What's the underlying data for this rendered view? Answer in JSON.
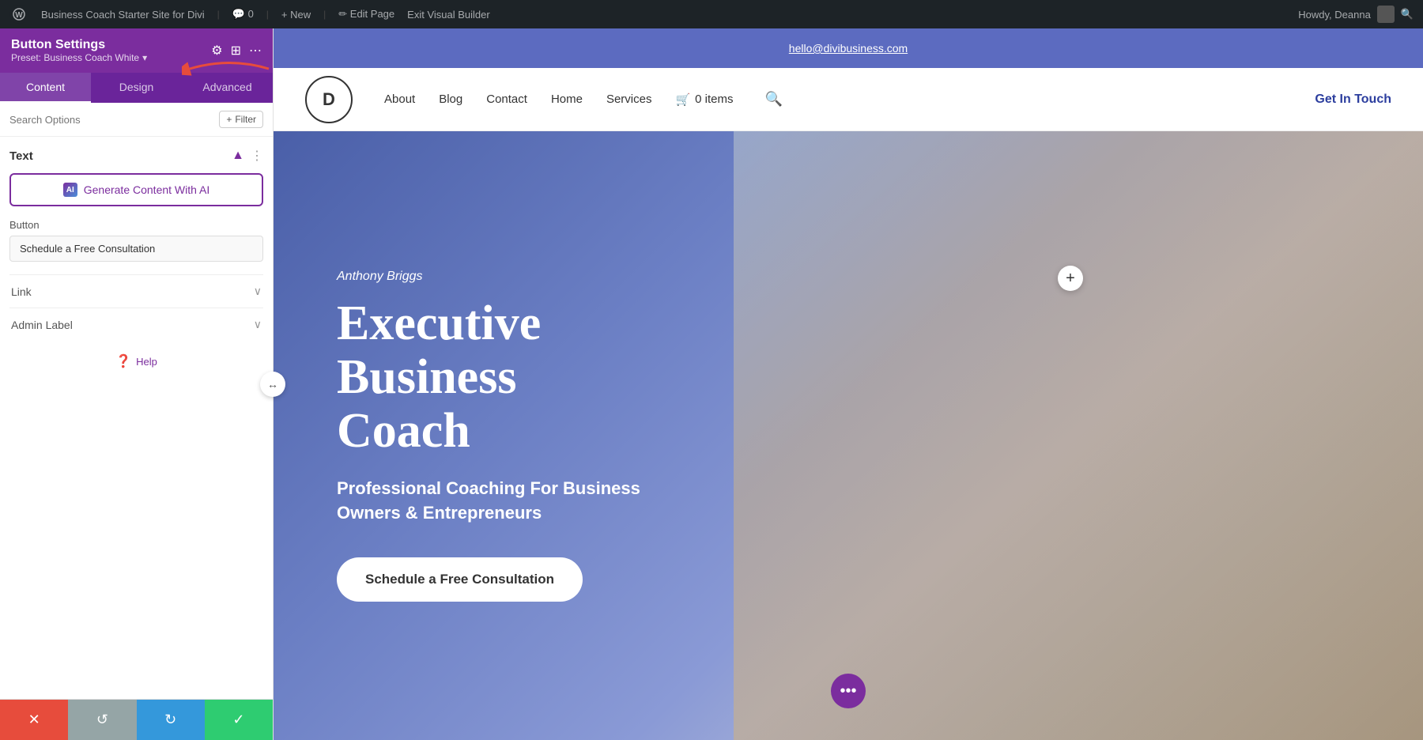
{
  "admin_bar": {
    "wp_logo": "W",
    "site_name": "Business Coach Starter Site for Divi",
    "comment_label": "💬 0",
    "new_label": "+ New",
    "edit_page_label": "✏ Edit Page",
    "exit_builder_label": "Exit Visual Builder",
    "howdy_label": "Howdy, Deanna",
    "search_icon": "🔍"
  },
  "sidebar": {
    "header_title": "Button Settings",
    "preset_label": "Preset: Business Coach White",
    "preset_arrow": "▾",
    "tabs": [
      {
        "label": "Content",
        "active": true
      },
      {
        "label": "Design",
        "active": false
      },
      {
        "label": "Advanced",
        "active": false
      }
    ],
    "search_placeholder": "Search Options",
    "filter_label": "⚡ Filter",
    "text_section": {
      "title": "Text",
      "generate_ai_label": "Generate Content With AI",
      "ai_icon_label": "AI"
    },
    "button_section": {
      "label": "Button",
      "value": "Schedule a Free Consultation"
    },
    "link_section": {
      "label": "Link"
    },
    "admin_label_section": {
      "label": "Admin Label"
    },
    "help_label": "Help"
  },
  "bottom_bar": {
    "close_icon": "✕",
    "undo_icon": "↺",
    "redo_icon": "↻",
    "save_icon": "✓"
  },
  "site": {
    "email": "hello@divibusiness.com",
    "logo_letter": "D",
    "nav": [
      {
        "label": "About"
      },
      {
        "label": "Blog"
      },
      {
        "label": "Contact"
      },
      {
        "label": "Home"
      },
      {
        "label": "Services"
      }
    ],
    "cart_icon": "🛒",
    "cart_items": "0 items",
    "search_icon": "🔍",
    "get_in_touch": "Get In Touch"
  },
  "hero": {
    "author": "Anthony Briggs",
    "title_line1": "Executive Business",
    "title_line2": "Coach",
    "subtitle": "Professional Coaching For Business Owners & Entrepreneurs",
    "cta_button": "Schedule a Free Consultation",
    "add_icon": "+",
    "dots_icon": "•••"
  }
}
